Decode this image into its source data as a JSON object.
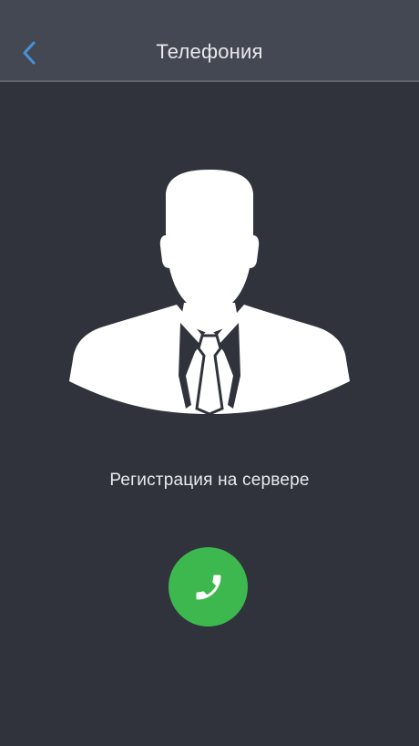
{
  "header": {
    "title": "Телефония",
    "back_icon": "chevron-left-icon",
    "accent_color": "#4a90d9"
  },
  "avatar": {
    "icon": "user-silhouette-icon"
  },
  "status": {
    "text": "Регистрация на сервере"
  },
  "call_button": {
    "icon": "phone-icon",
    "color": "#3db84e"
  }
}
